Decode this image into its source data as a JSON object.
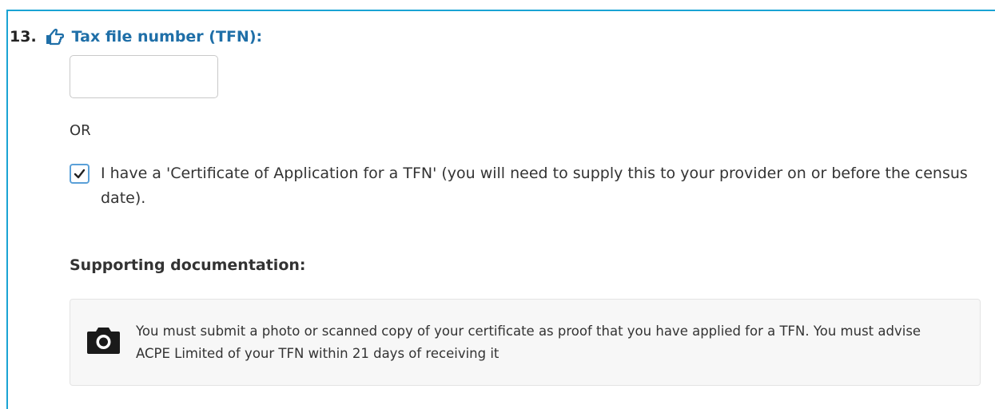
{
  "question": {
    "number": "13.",
    "icon": "hand-pointer-icon",
    "title": "Tax file number (TFN):",
    "title_color": "#1f6fa8"
  },
  "tfn_input": {
    "value": "",
    "placeholder": ""
  },
  "or_text": "OR",
  "certificate": {
    "checked": true,
    "label": "I have a 'Certificate of Application for a TFN' (you will need to supply this to your provider on or before the census date)."
  },
  "supporting": {
    "heading": "Supporting documentation:",
    "icon": "camera-icon",
    "message": "You must submit a photo or scanned copy of your certificate as proof that you have applied for a TFN. You must advise ACPE Limited of your TFN within 21 days of receiving it"
  },
  "colors": {
    "accent_border": "#1aa3d4",
    "checkbox_border": "#5aa0d8"
  }
}
